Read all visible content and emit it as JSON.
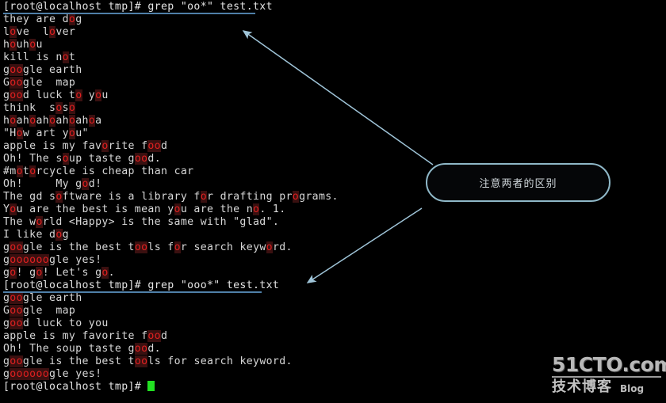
{
  "terminal": {
    "prompt": "[root@localhost tmp]# ",
    "cursor_color": "#22e022",
    "match_color": "#e02020",
    "match_background": "#3a1010",
    "text_color": "#d8d8d8",
    "background": "#000000",
    "blocks": [
      {
        "command": "grep \"oo*\" test.txt",
        "underlined": true,
        "output": [
          [
            {
              "t": "they are d",
              "m": false
            },
            {
              "t": "o",
              "m": true
            },
            {
              "t": "g",
              "m": false
            }
          ],
          [
            {
              "t": "l",
              "m": false
            },
            {
              "t": "o",
              "m": true
            },
            {
              "t": "ve  l",
              "m": false
            },
            {
              "t": "o",
              "m": true
            },
            {
              "t": "ver",
              "m": false
            }
          ],
          [
            {
              "t": "h",
              "m": false
            },
            {
              "t": "o",
              "m": true
            },
            {
              "t": "uh",
              "m": false
            },
            {
              "t": "o",
              "m": true
            },
            {
              "t": "u",
              "m": false
            }
          ],
          [
            {
              "t": "kill is n",
              "m": false
            },
            {
              "t": "o",
              "m": true
            },
            {
              "t": "t",
              "m": false
            }
          ],
          [
            {
              "t": "g",
              "m": false
            },
            {
              "t": "oo",
              "m": true
            },
            {
              "t": "gle earth",
              "m": false
            }
          ],
          [
            {
              "t": "G",
              "m": false
            },
            {
              "t": "oo",
              "m": true
            },
            {
              "t": "gle  map",
              "m": false
            }
          ],
          [
            {
              "t": "g",
              "m": false
            },
            {
              "t": "oo",
              "m": true
            },
            {
              "t": "d luck t",
              "m": false
            },
            {
              "t": "o",
              "m": true
            },
            {
              "t": " y",
              "m": false
            },
            {
              "t": "o",
              "m": true
            },
            {
              "t": "u",
              "m": false
            }
          ],
          [
            {
              "t": "think  s",
              "m": false
            },
            {
              "t": "o",
              "m": true
            },
            {
              "t": "s",
              "m": false
            },
            {
              "t": "o",
              "m": true
            }
          ],
          [
            {
              "t": "h",
              "m": false
            },
            {
              "t": "o",
              "m": true
            },
            {
              "t": "ah",
              "m": false
            },
            {
              "t": "o",
              "m": true
            },
            {
              "t": "ah",
              "m": false
            },
            {
              "t": "o",
              "m": true
            },
            {
              "t": "ah",
              "m": false
            },
            {
              "t": "o",
              "m": true
            },
            {
              "t": "ah",
              "m": false
            },
            {
              "t": "o",
              "m": true
            },
            {
              "t": "a",
              "m": false
            }
          ],
          [
            {
              "t": "\"H",
              "m": false
            },
            {
              "t": "o",
              "m": true
            },
            {
              "t": "w art y",
              "m": false
            },
            {
              "t": "o",
              "m": true
            },
            {
              "t": "u\"",
              "m": false
            }
          ],
          [
            {
              "t": "apple is my fav",
              "m": false
            },
            {
              "t": "o",
              "m": true
            },
            {
              "t": "rite f",
              "m": false
            },
            {
              "t": "oo",
              "m": true
            },
            {
              "t": "d",
              "m": false
            }
          ],
          [
            {
              "t": "Oh! The s",
              "m": false
            },
            {
              "t": "o",
              "m": true
            },
            {
              "t": "up taste g",
              "m": false
            },
            {
              "t": "oo",
              "m": true
            },
            {
              "t": "d.",
              "m": false
            }
          ],
          [
            {
              "t": "#m",
              "m": false
            },
            {
              "t": "o",
              "m": true
            },
            {
              "t": "t",
              "m": false
            },
            {
              "t": "o",
              "m": true
            },
            {
              "t": "rcycle is cheap than car",
              "m": false
            }
          ],
          [
            {
              "t": "Oh!     My g",
              "m": false
            },
            {
              "t": "o",
              "m": true
            },
            {
              "t": "d!",
              "m": false
            }
          ],
          [
            {
              "t": "The gd s",
              "m": false
            },
            {
              "t": "o",
              "m": true
            },
            {
              "t": "ftware is a library f",
              "m": false
            },
            {
              "t": "o",
              "m": true
            },
            {
              "t": "r drafting pr",
              "m": false
            },
            {
              "t": "o",
              "m": true
            },
            {
              "t": "grams.",
              "m": false
            }
          ],
          [
            {
              "t": "Y",
              "m": false
            },
            {
              "t": "o",
              "m": true
            },
            {
              "t": "u are the best is mean y",
              "m": false
            },
            {
              "t": "o",
              "m": true
            },
            {
              "t": "u are the n",
              "m": false
            },
            {
              "t": "o",
              "m": true
            },
            {
              "t": ". 1.",
              "m": false
            }
          ],
          [
            {
              "t": "The w",
              "m": false
            },
            {
              "t": "o",
              "m": true
            },
            {
              "t": "rld <Happy> is the same with \"glad\".",
              "m": false
            }
          ],
          [
            {
              "t": "I like d",
              "m": false
            },
            {
              "t": "o",
              "m": true
            },
            {
              "t": "g",
              "m": false
            }
          ],
          [
            {
              "t": "g",
              "m": false
            },
            {
              "t": "oo",
              "m": true
            },
            {
              "t": "gle is the best t",
              "m": false
            },
            {
              "t": "oo",
              "m": true
            },
            {
              "t": "ls f",
              "m": false
            },
            {
              "t": "o",
              "m": true
            },
            {
              "t": "r search keyw",
              "m": false
            },
            {
              "t": "o",
              "m": true
            },
            {
              "t": "rd.",
              "m": false
            }
          ],
          [
            {
              "t": "g",
              "m": false
            },
            {
              "t": "oooooo",
              "m": true
            },
            {
              "t": "gle yes!",
              "m": false
            }
          ],
          [
            {
              "t": "g",
              "m": false
            },
            {
              "t": "o",
              "m": true
            },
            {
              "t": "! g",
              "m": false
            },
            {
              "t": "o",
              "m": true
            },
            {
              "t": "! Let's g",
              "m": false
            },
            {
              "t": "o",
              "m": true
            },
            {
              "t": ".",
              "m": false
            }
          ]
        ]
      },
      {
        "command": "grep \"ooo*\" test.txt",
        "underlined": true,
        "output": [
          [
            {
              "t": "g",
              "m": false
            },
            {
              "t": "oo",
              "m": true
            },
            {
              "t": "gle earth",
              "m": false
            }
          ],
          [
            {
              "t": "G",
              "m": false
            },
            {
              "t": "oo",
              "m": true
            },
            {
              "t": "gle  map",
              "m": false
            }
          ],
          [
            {
              "t": "g",
              "m": false
            },
            {
              "t": "oo",
              "m": true
            },
            {
              "t": "d luck to you",
              "m": false
            }
          ],
          [
            {
              "t": "apple is my favorite f",
              "m": false
            },
            {
              "t": "oo",
              "m": true
            },
            {
              "t": "d",
              "m": false
            }
          ],
          [
            {
              "t": "Oh! The soup taste g",
              "m": false
            },
            {
              "t": "oo",
              "m": true
            },
            {
              "t": "d.",
              "m": false
            }
          ],
          [
            {
              "t": "g",
              "m": false
            },
            {
              "t": "oo",
              "m": true
            },
            {
              "t": "gle is the best t",
              "m": false
            },
            {
              "t": "oo",
              "m": true
            },
            {
              "t": "ls for search keyword.",
              "m": false
            }
          ],
          [
            {
              "t": "g",
              "m": false
            },
            {
              "t": "oooooo",
              "m": true
            },
            {
              "t": "gle yes!",
              "m": false
            }
          ]
        ]
      }
    ],
    "final_prompt": "[root@localhost tmp]# "
  },
  "annotation": {
    "callout_label": "注意两者的区别",
    "border_color": "#8fb8c8",
    "arrow_color": "#9fc4d8",
    "underline_color": "#4f7fa8"
  },
  "watermark": {
    "site": "51CTO.com",
    "subtitle": "技术博客",
    "blog_label": "Blog"
  }
}
